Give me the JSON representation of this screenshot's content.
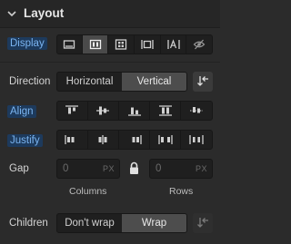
{
  "section": {
    "title": "Layout",
    "collapse_icon": "chevron-down-icon"
  },
  "display": {
    "label": "Display",
    "options": [
      "block-icon",
      "flex-icon",
      "grid-icon",
      "inline-block-icon",
      "inline-icon",
      "none-icon"
    ],
    "active_index": 1
  },
  "direction": {
    "label": "Direction",
    "options": [
      "Horizontal",
      "Vertical"
    ],
    "active": "Vertical",
    "swap_icon": "reverse-direction-icon"
  },
  "align": {
    "label": "Align",
    "options": [
      "align-start-icon",
      "align-center-icon",
      "align-end-icon",
      "align-stretch-icon",
      "align-baseline-icon"
    ],
    "active_index": null
  },
  "justify": {
    "label": "Justify",
    "options": [
      "justify-start-icon",
      "justify-center-icon",
      "justify-end-icon",
      "justify-space-between-icon",
      "justify-space-around-icon"
    ],
    "active_index": null
  },
  "gap": {
    "label": "Gap",
    "columns": {
      "value": "0",
      "unit": "PX",
      "label": "Columns"
    },
    "rows": {
      "value": "0",
      "unit": "PX",
      "label": "Rows"
    },
    "lock_icon": "lock-icon"
  },
  "children": {
    "label": "Children",
    "options": [
      "Don't wrap",
      "Wrap"
    ],
    "active": "Wrap",
    "swap_icon": "reverse-wrap-icon"
  },
  "colors": {
    "accent": "#7ab4f0",
    "highlight_bg": "#1d3a5c",
    "panel": "#2b2b2b",
    "field": "#1f1f1f",
    "active": "#4a4a4a"
  }
}
